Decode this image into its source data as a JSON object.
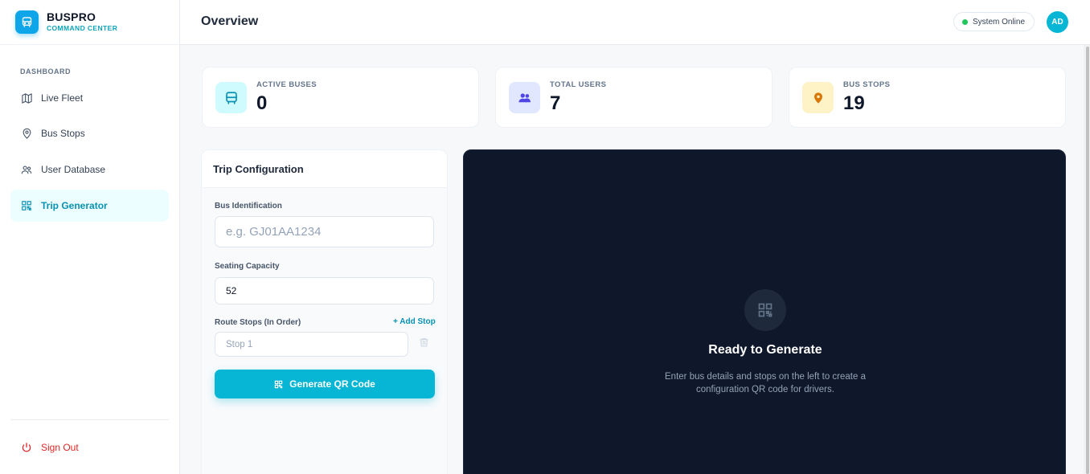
{
  "brand": {
    "name": "BUSPRO",
    "subtitle": "COMMAND CENTER"
  },
  "sidebar": {
    "section": "DASHBOARD",
    "items": [
      {
        "label": "Live Fleet",
        "icon": "map-icon"
      },
      {
        "label": "Bus Stops",
        "icon": "map-pin-icon"
      },
      {
        "label": "User Database",
        "icon": "users-icon"
      },
      {
        "label": "Trip Generator",
        "icon": "qr-code-icon",
        "active": true
      }
    ],
    "sign_out": "Sign Out"
  },
  "header": {
    "title": "Overview",
    "status": "System Online",
    "avatar": "AD"
  },
  "stats": [
    {
      "label": "ACTIVE BUSES",
      "value": "0",
      "icon": "bus-icon",
      "color": "#0891b2"
    },
    {
      "label": "TOTAL USERS",
      "value": "7",
      "icon": "users-icon",
      "color": "#4f46e5"
    },
    {
      "label": "BUS STOPS",
      "value": "19",
      "icon": "map-pin-icon",
      "color": "#d97706"
    }
  ],
  "config": {
    "title": "Trip Configuration",
    "bus_label": "Bus Identification",
    "bus_placeholder": "e.g. GJ01AA1234",
    "capacity_label": "Seating Capacity",
    "capacity_value": "52",
    "stops_label": "Route Stops (In Order)",
    "add_stop": "+ Add Stop",
    "stop_placeholder": "Stop 1",
    "generate_label": "Generate QR Code"
  },
  "preview": {
    "title": "Ready to Generate",
    "description": "Enter bus details and stops on the left to create a configuration QR code for drivers."
  },
  "colors": {
    "accent": "#06b6d4",
    "preview_bg": "#0f172a",
    "danger": "#dc2626",
    "online": "#22c55e"
  }
}
